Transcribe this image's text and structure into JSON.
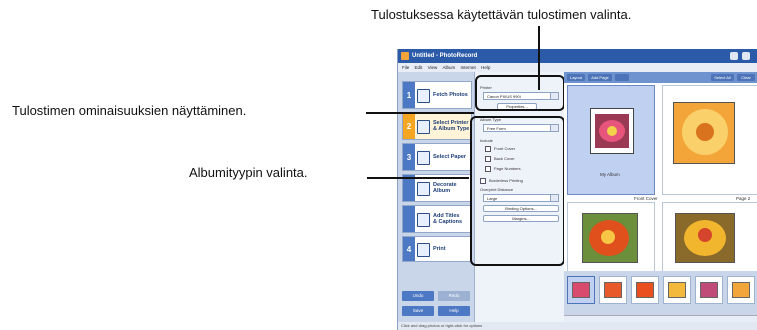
{
  "callouts": {
    "printer": "Tulostuksessa käytettävän tulostimen valinta.",
    "properties": "Tulostimen ominaisuuksien näyttäminen.",
    "album_type": "Albumityypin valinta."
  },
  "window": {
    "title": "Untitled - PhotoRecord",
    "menu": [
      "File",
      "Edit",
      "View",
      "Album",
      "Internet",
      "Help"
    ],
    "status": "Click and drag photos or right-click for options"
  },
  "steps": [
    {
      "num": "1",
      "label": "Fetch Photos"
    },
    {
      "num": "2",
      "label": "Select Printer\n& Album Type"
    },
    {
      "num": "3",
      "label": "Select Paper"
    },
    {
      "num": "",
      "label": "Decorate\nAlbum"
    },
    {
      "num": "",
      "label": "Add Titles\n& Captions"
    },
    {
      "num": "4",
      "label": "Print"
    }
  ],
  "sidebar_buttons": {
    "undo": "Undo",
    "redo": "Redo",
    "save": "Save",
    "help": "Help"
  },
  "settings": {
    "printer_label": "Printer",
    "printer_value": "Canon PIXUS 990i",
    "properties_btn": "Properties...",
    "album_type_label": "Album Type",
    "album_type_value": "Free Form",
    "include_label": "Include",
    "include_items": [
      "Front Cover",
      "Back Cover",
      "Page Numbers"
    ],
    "borderless": "Borderless Printing",
    "overprint_label": "Overprint Distance",
    "overprint_value": "Large",
    "binding_btn": "Binding Options...",
    "margins_btn": "Margins..."
  },
  "toolbar": {
    "layout": "Layout",
    "add_page": "Add Page",
    "select_all": "Select All",
    "clear": "Clear"
  },
  "pages": {
    "my_album": "My Album",
    "front_cover": "Front Cover",
    "page2": "Page 2"
  }
}
